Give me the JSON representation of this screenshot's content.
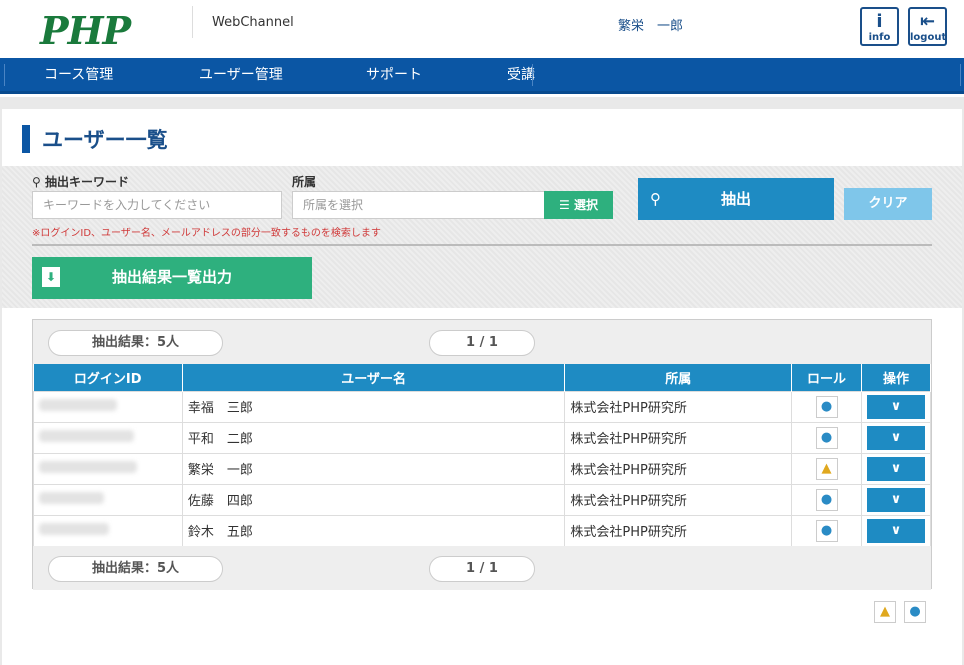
{
  "header": {
    "logo": "PHP",
    "channel": "WebChannel",
    "user": "繁栄　一郎",
    "info_label": "info",
    "logout_label": "logout"
  },
  "nav": {
    "items": [
      "コース管理",
      "ユーザー管理",
      "サポート",
      "受講"
    ]
  },
  "page": {
    "title": "ユーザー一覧"
  },
  "filter": {
    "keyword_label": "抽出キーワード",
    "keyword_placeholder": "キーワードを入力してください",
    "org_label": "所属",
    "org_placeholder": "所属を選択",
    "select_label": "選択",
    "extract_label": "抽出",
    "clear_label": "クリア",
    "note": "※ログインID、ユーザー名、メールアドレスの部分一致するものを検索します",
    "export_label": "抽出結果一覧出力"
  },
  "results": {
    "count_label": "抽出結果：5人",
    "page_label": "1 / 1",
    "columns": [
      "ログインID",
      "ユーザー名",
      "所属",
      "ロール",
      "操作"
    ],
    "rows": [
      {
        "user": "幸福　三郎",
        "org": "株式会社PHP研究所",
        "role": "user"
      },
      {
        "user": "平和　二郎",
        "org": "株式会社PHP研究所",
        "role": "user"
      },
      {
        "user": "繁栄　一郎",
        "org": "株式会社PHP研究所",
        "role": "admin"
      },
      {
        "user": "佐藤　四郎",
        "org": "株式会社PHP研究所",
        "role": "user"
      },
      {
        "user": "鈴木　五郎",
        "org": "株式会社PHP研究所",
        "role": "user"
      }
    ]
  },
  "colors": {
    "nav": "#0b56a4",
    "table_header": "#1e8bc3",
    "green": "#2eb07e",
    "admin_icon": "#e0a81e",
    "user_icon": "#2a8bc5"
  }
}
